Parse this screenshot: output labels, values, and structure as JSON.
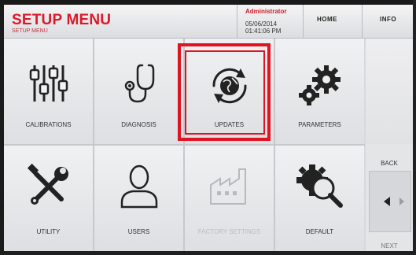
{
  "header": {
    "title": "SETUP MENU",
    "subtitle": "SETUP MENU",
    "user": "Administrator",
    "date": "05/06/2014",
    "time": "01:41:06 PM",
    "home_label": "HOME",
    "info_label": "INFO"
  },
  "tiles": [
    {
      "label": "CALIBRATIONS",
      "icon": "sliders-icon"
    },
    {
      "label": "DIAGNOSIS",
      "icon": "stethoscope-icon"
    },
    {
      "label": "UPDATES",
      "icon": "globe-sync-icon"
    },
    {
      "label": "PARAMETERS",
      "icon": "gears-icon"
    },
    {
      "label": "UTILITY",
      "icon": "tools-icon"
    },
    {
      "label": "USERS",
      "icon": "user-icon"
    },
    {
      "label": "FACTORY SETTINGS",
      "icon": "factory-icon",
      "disabled": true
    },
    {
      "label": "DEFAULT",
      "icon": "gear-search-icon"
    }
  ],
  "sidebar": {
    "back_label": "BACK",
    "next_label": "NEXT"
  },
  "colors": {
    "accent": "#d91a2a",
    "highlight": "#e01322"
  }
}
